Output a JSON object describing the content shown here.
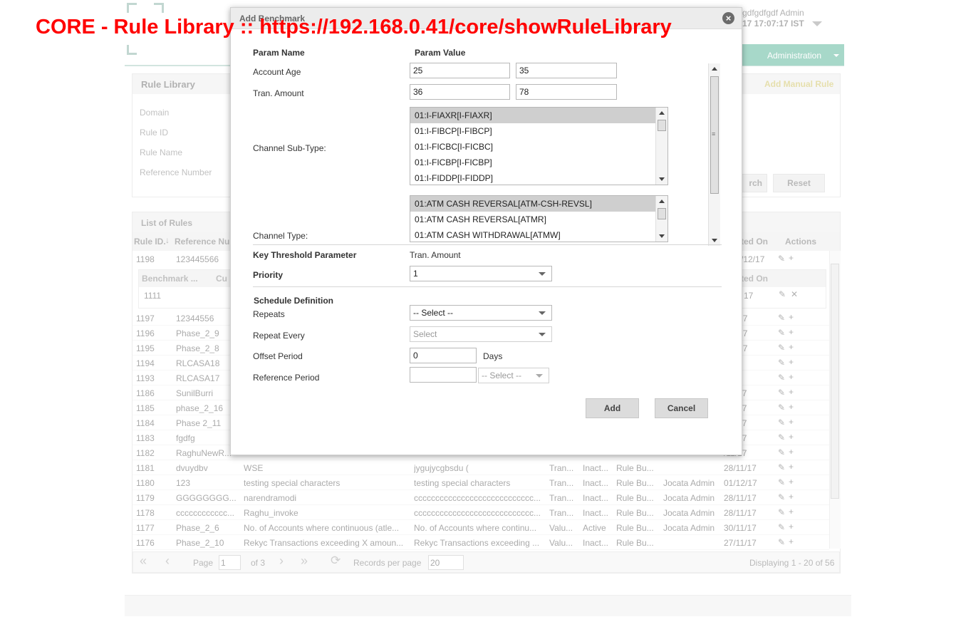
{
  "overlay_title": "CORE - Rule Library :: https://192.168.0.41/core/showRuleLibrary",
  "header": {
    "user_name": "gdfgdfgdf Admin",
    "user_datetime": "17 17:07:17 IST",
    "nav_administration": "Administration"
  },
  "search_panel": {
    "title": "Rule Library",
    "add_manual_rule": "Add Manual Rule",
    "fields": [
      "Domain",
      "Rule ID",
      "Rule Name",
      "Reference Number"
    ],
    "search_button": "rch",
    "reset_button": "Reset"
  },
  "rules_panel": {
    "title": "List of Rules",
    "col_rule_id": "Rule ID.",
    "col_reference": "Reference Nu",
    "col_created_on": "ted On",
    "col_actions": "Actions",
    "sub_col_benchmark": "Benchmark ...",
    "sub_col_cu": "Cu",
    "sub_col_created_on": "ted On",
    "expanded_row": {
      "id": "1198",
      "ref": "123445566",
      "date": "/12/17"
    },
    "benchmark_row": {
      "value": "1111",
      "date": "17"
    },
    "rows": [
      {
        "id": "1197",
        "ref": "12344556",
        "name": "",
        "desc": "",
        "t": "",
        "s": "",
        "cat": "",
        "by": "",
        "date": "/12/17"
      },
      {
        "id": "1196",
        "ref": "Phase_2_9",
        "name": "",
        "desc": "",
        "t": "",
        "s": "",
        "cat": "",
        "by": "",
        "date": "/12/17"
      },
      {
        "id": "1195",
        "ref": "Phase_2_8",
        "name": "",
        "desc": "",
        "t": "",
        "s": "",
        "cat": "",
        "by": "",
        "date": "/12/17"
      },
      {
        "id": "1194",
        "ref": "RLCASA18",
        "name": "",
        "desc": "",
        "t": "",
        "s": "",
        "cat": "",
        "by": "",
        "date": ""
      },
      {
        "id": "1193",
        "ref": "RLCASA17",
        "name": "",
        "desc": "",
        "t": "",
        "s": "",
        "cat": "",
        "by": "",
        "date": ""
      },
      {
        "id": "1186",
        "ref": "SunilBurri",
        "name": "",
        "desc": "",
        "t": "",
        "s": "",
        "cat": "",
        "by": "",
        "date": "/11/17"
      },
      {
        "id": "1185",
        "ref": "phase_2_16",
        "name": "",
        "desc": "",
        "t": "",
        "s": "",
        "cat": "",
        "by": "",
        "date": "/11/17"
      },
      {
        "id": "1184",
        "ref": "Phase 2_11",
        "name": "",
        "desc": "",
        "t": "",
        "s": "",
        "cat": "",
        "by": "",
        "date": "/11/17"
      },
      {
        "id": "1183",
        "ref": "fgdfg",
        "name": "",
        "desc": "",
        "t": "",
        "s": "",
        "cat": "",
        "by": "",
        "date": "/11/17"
      },
      {
        "id": "1182",
        "ref": "RaghuNewR...",
        "name": "",
        "desc": "",
        "t": "",
        "s": "",
        "cat": "",
        "by": "",
        "date": "/11/17"
      },
      {
        "id": "1181",
        "ref": "dvuydbv",
        "name": "WSE",
        "desc": "jygujycgbsdu (",
        "t": "Tran...",
        "s": "Inact...",
        "cat": "Rule Bu...",
        "by": "",
        "date": "28/11/17"
      },
      {
        "id": "1180",
        "ref": "123",
        "name": "testing special characters",
        "desc": "testing special characters",
        "t": "Tran...",
        "s": "Inact...",
        "cat": "Rule Bu...",
        "by": "Jocata Admin",
        "date": "01/12/17"
      },
      {
        "id": "1179",
        "ref": "GGGGGGGG...",
        "name": "narendramodi",
        "desc": "cccccccccccccccccccccccccccc...",
        "t": "Tran...",
        "s": "Inact...",
        "cat": "Rule Bu...",
        "by": "Jocata Admin",
        "date": "28/11/17"
      },
      {
        "id": "1178",
        "ref": "cccccccccccc...",
        "name": "Raghu_invoke",
        "desc": "cccccccccccccccccccccccccccc...",
        "t": "Tran...",
        "s": "Inact...",
        "cat": "Rule Bu...",
        "by": "Jocata Admin",
        "date": "28/11/17"
      },
      {
        "id": "1177",
        "ref": "Phase_2_6",
        "name": "No. of Accounts where continuous (atle...",
        "desc": "No. of Accounts where continu...",
        "t": "Valu...",
        "s": "Active",
        "cat": "Rule Bu...",
        "by": "Jocata Admin",
        "date": "30/11/17"
      },
      {
        "id": "1176",
        "ref": "Phase_2_10",
        "name": "Rekyc Transactions exceeding X amoun...",
        "desc": "Rekyc Transactions exceeding ...",
        "t": "Valu...",
        "s": "Inact...",
        "cat": "Rule Bu...",
        "by": "",
        "date": "27/11/17"
      }
    ],
    "pager": {
      "page_label": "Page",
      "page_value": "1",
      "of_label": "of 3",
      "records_label": "Records per page",
      "records_value": "20",
      "displaying": "Displaying 1 - 20 of 56"
    }
  },
  "modal": {
    "title": "Add Benchmark",
    "col_param_name": "Param Name",
    "col_param_value": "Param Value",
    "account_age": {
      "label": "Account Age",
      "from": "25",
      "to": "35"
    },
    "tran_amount": {
      "label": "Tran. Amount",
      "from": "36",
      "to": "78"
    },
    "channel_sub_type": {
      "label": "Channel Sub-Type:",
      "options": [
        "01:I-FIAXR[I-FIAXR]",
        "01:I-FIBCP[I-FIBCP]",
        "01:I-FICBC[I-FICBC]",
        "01:I-FICBP[I-FICBP]",
        "01:I-FIDDP[I-FIDDP]"
      ]
    },
    "channel_type": {
      "label": "Channel Type:",
      "options": [
        "01:ATM CASH REVERSAL[ATM-CSH-REVSL]",
        "01:ATM CASH REVERSAL[ATMR]",
        "01:ATM CASH WITHDRAWAL[ATMW]"
      ]
    },
    "key_threshold": {
      "label": "Key Threshold Parameter",
      "value": "Tran. Amount"
    },
    "priority": {
      "label": "Priority",
      "value": "1"
    },
    "schedule": {
      "heading": "Schedule Definition",
      "repeats_label": "Repeats",
      "repeats_value": "-- Select --",
      "repeat_every_label": "Repeat Every",
      "repeat_every_value": "Select",
      "offset_label": "Offset Period",
      "offset_value": "0",
      "offset_unit": "Days",
      "reference_label": "Reference Period",
      "reference_value": "",
      "reference_select": "-- Select --"
    },
    "add_button": "Add",
    "cancel_button": "Cancel"
  }
}
